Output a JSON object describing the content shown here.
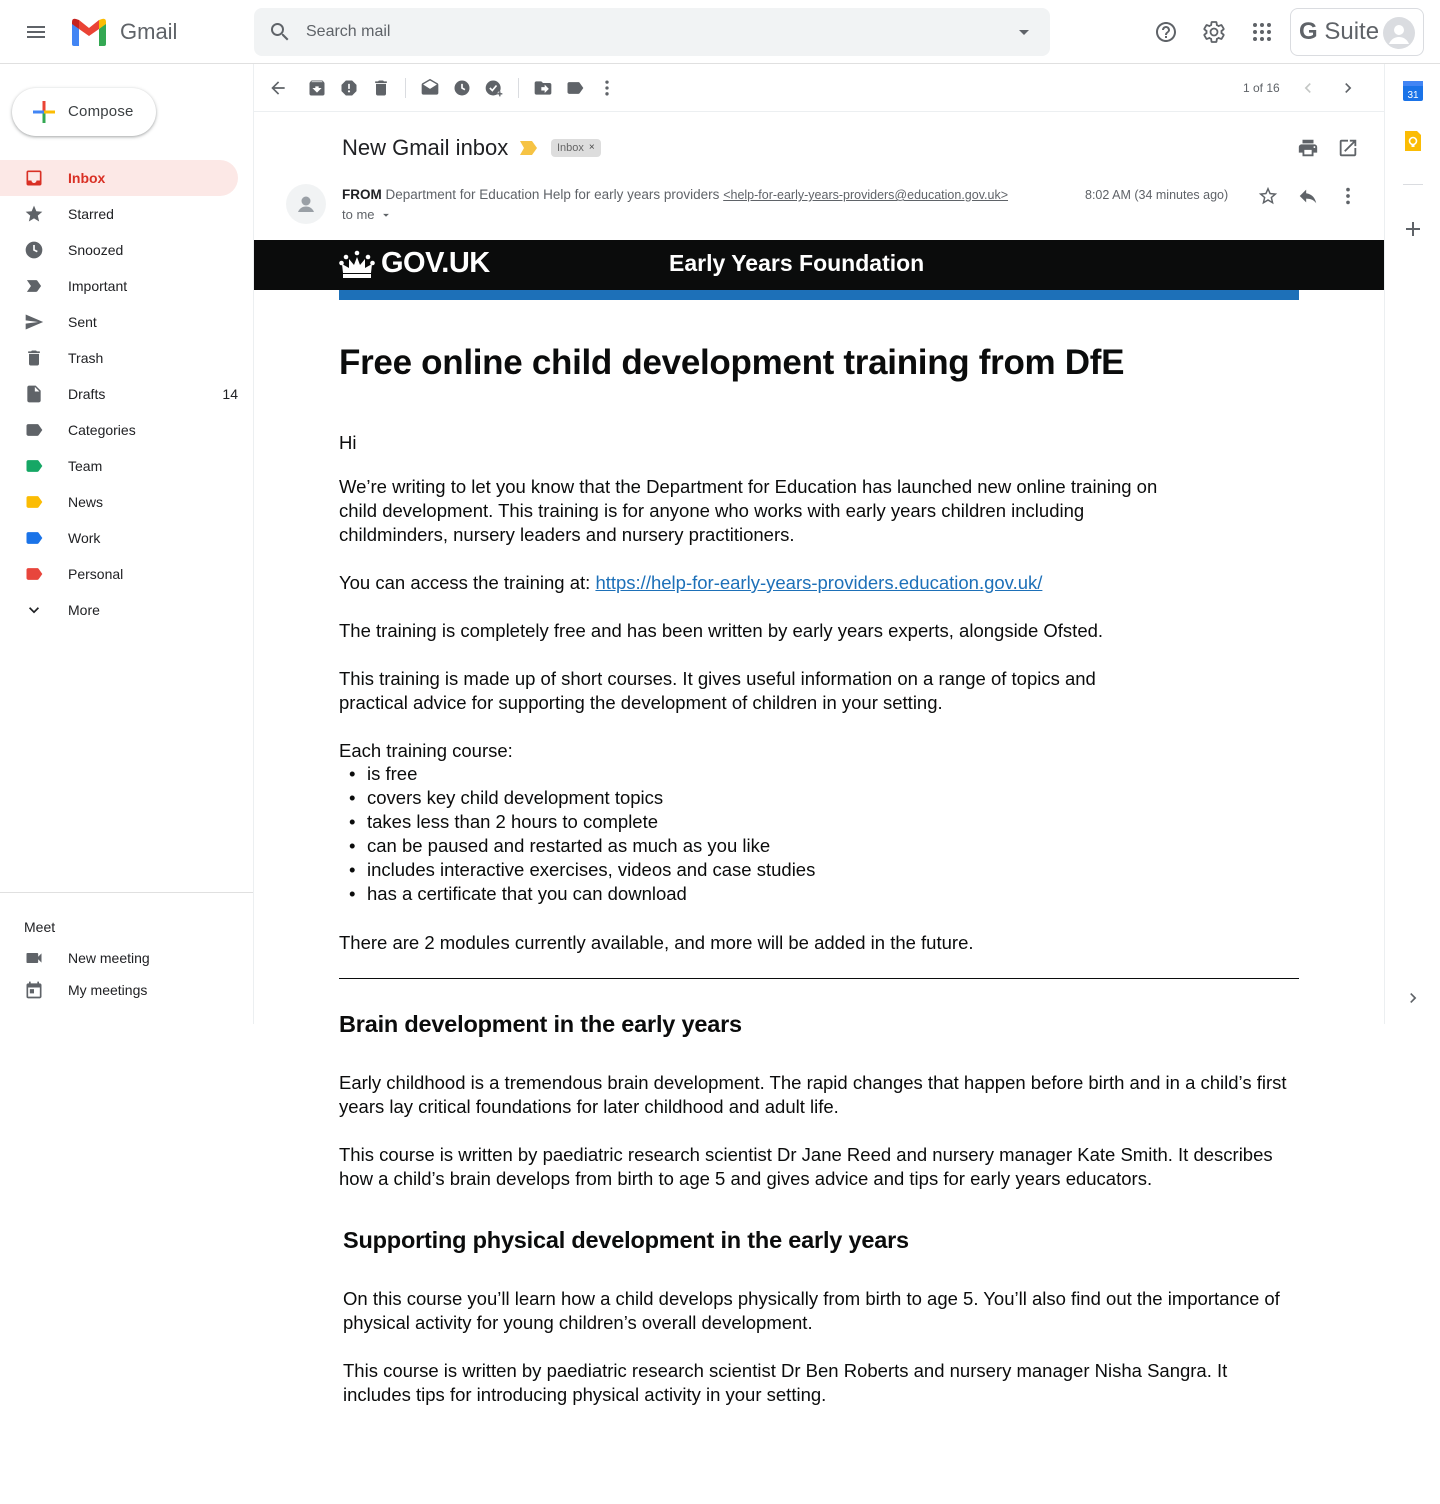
{
  "header": {
    "app_name": "Gmail",
    "search_placeholder": "Search mail",
    "gsuite_g": "G",
    "gsuite_label": "Suite"
  },
  "sidebar": {
    "compose_label": "Compose",
    "items": [
      {
        "label": "Inbox",
        "icon": "inbox-icon",
        "count": "",
        "color": "#d93025",
        "active": true
      },
      {
        "label": "Starred",
        "icon": "star-icon",
        "count": ""
      },
      {
        "label": "Snoozed",
        "icon": "clock-icon",
        "count": ""
      },
      {
        "label": "Important",
        "icon": "important-icon",
        "count": ""
      },
      {
        "label": "Sent",
        "icon": "send-icon",
        "count": ""
      },
      {
        "label": "Trash",
        "icon": "trash-icon",
        "count": ""
      },
      {
        "label": "Drafts",
        "icon": "draft-icon",
        "count": "14"
      },
      {
        "label": "Categories",
        "icon": "label-icon",
        "count": "",
        "color": "#5f6368"
      },
      {
        "label": "Team",
        "icon": "label-icon",
        "count": "",
        "color": "#16a765"
      },
      {
        "label": "News",
        "icon": "label-icon",
        "count": "",
        "color": "#fbbc04"
      },
      {
        "label": "Work",
        "icon": "label-icon",
        "count": "",
        "color": "#1a73e8"
      },
      {
        "label": "Personal",
        "icon": "label-icon",
        "count": "",
        "color": "#e8453c"
      },
      {
        "label": "More",
        "icon": "chevron-down-icon",
        "count": ""
      }
    ],
    "meet": {
      "title": "Meet",
      "new_meeting": "New meeting",
      "my_meetings": "My meetings"
    }
  },
  "toolbar": {
    "pager": "1 of 16"
  },
  "email": {
    "subject": "New Gmail inbox",
    "label_chip": "Inbox",
    "chip_close": "×",
    "from_prefix": "FROM",
    "from_name": "Department for Education Help for early years providers",
    "from_email": "<help-for-early-years-providers@education.gov.uk>",
    "to": "to me",
    "time": "8:02 AM (34 minutes ago)"
  },
  "banner": {
    "gov_logo": "GOV.UK",
    "service_name": "Early Years Foundation"
  },
  "body": {
    "title": "Free online child development training from DfE",
    "greeting": "Hi",
    "p1": "We’re writing to let you know that the Department for Education has launched new online training on child development. This training is for anyone who works with early years children including childminders, nursery leaders and nursery practitioners.",
    "p2_prefix": "You can access the training at: ",
    "p2_link": "https://help-for-early-years-providers.education.gov.uk/",
    "p3": "The training is completely free and has been written by early years experts, alongside Ofsted.",
    "p4": "This training is made up of short courses. It gives useful information on a range of topics and practical advice for supporting the development of children in your setting.",
    "list_intro": "Each training course:",
    "list": [
      "is free",
      "covers key child development topics",
      "takes less than 2 hours to complete",
      "can be paused and restarted as much as you like",
      "includes interactive exercises, videos and case studies",
      "has a certificate that you can download"
    ],
    "p5": "There are 2 modules currently available, and more will be added in the future.",
    "h2_brain": "Brain development in the early years",
    "brain_p1": "Early childhood is a tremendous brain development. The rapid changes that happen before birth and in a child’s first years lay critical foundations for later childhood and adult life.",
    "brain_p2": "This course is written by paediatric research scientist Dr Jane Reed and nursery manager Kate Smith. It describes how a child’s brain develops from birth to age 5 and gives advice and tips for early years educators.",
    "h2_physical": "Supporting physical development in the early years",
    "phys_p1": "On this course you’ll learn how a child develops physically from birth to age 5. You’ll also find out the importance of physical activity for young children’s overall development.",
    "phys_p2": "This course is written by paediatric research scientist Dr Ben Roberts and nursery manager Nisha Sangra. It includes tips for introducing physical activity in your setting."
  },
  "sidepanel": {
    "calendar_day": "31"
  },
  "colors": {
    "accent": "#d93025",
    "gov_black": "#0b0c0c",
    "gov_blue": "#1d70b8"
  }
}
